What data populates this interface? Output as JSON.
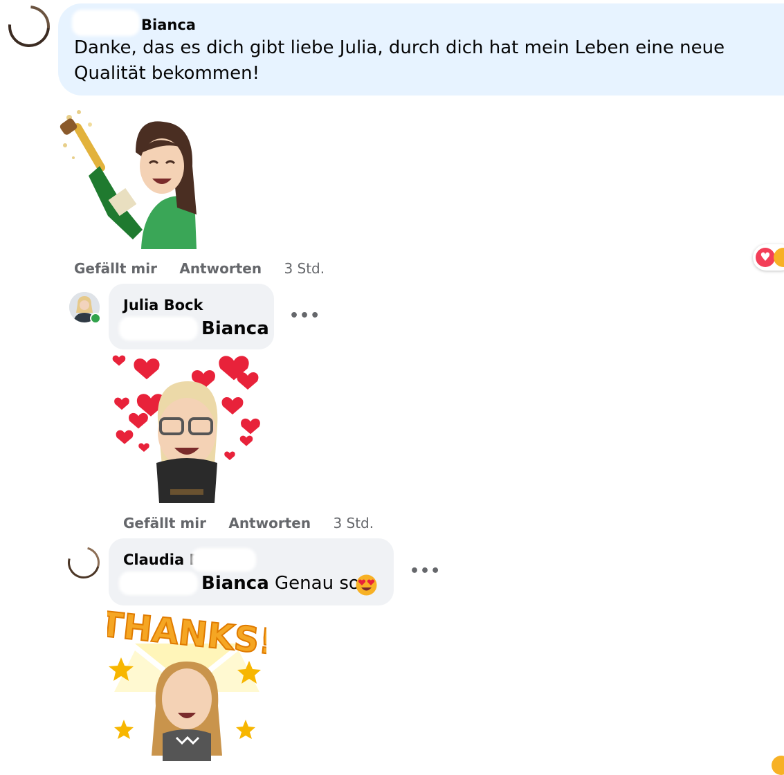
{
  "comments": [
    {
      "author": "Bianca",
      "text": "Danke, das es dich gibt liebe Julia, durch dich hat mein Leben eine neue Qualität bekommen!",
      "actions": {
        "like": "Gefällt mir",
        "reply": "Antworten",
        "time": "3 Std."
      }
    },
    {
      "author": "Julia Bock",
      "mention": "Bianca",
      "actions": {
        "like": "Gefällt mir",
        "reply": "Antworten",
        "time": "3 Std."
      },
      "more": "•••"
    },
    {
      "author": "Claudia F",
      "mention": "Bianca",
      "text": "Genau so!",
      "more": "•••"
    }
  ],
  "stickers": [
    {
      "name": "champagne-celebration-avatar-sticker"
    },
    {
      "name": "hearts-avatar-sticker"
    },
    {
      "name": "thanks-avatar-sticker",
      "caption": "THANKS!"
    }
  ],
  "reactions": [
    "heart-icon",
    "care-icon"
  ],
  "colors": {
    "bubble_main": "#e7f3ff",
    "bubble_reply": "#f0f2f5",
    "muted": "#65676b",
    "online": "#31a24c"
  }
}
